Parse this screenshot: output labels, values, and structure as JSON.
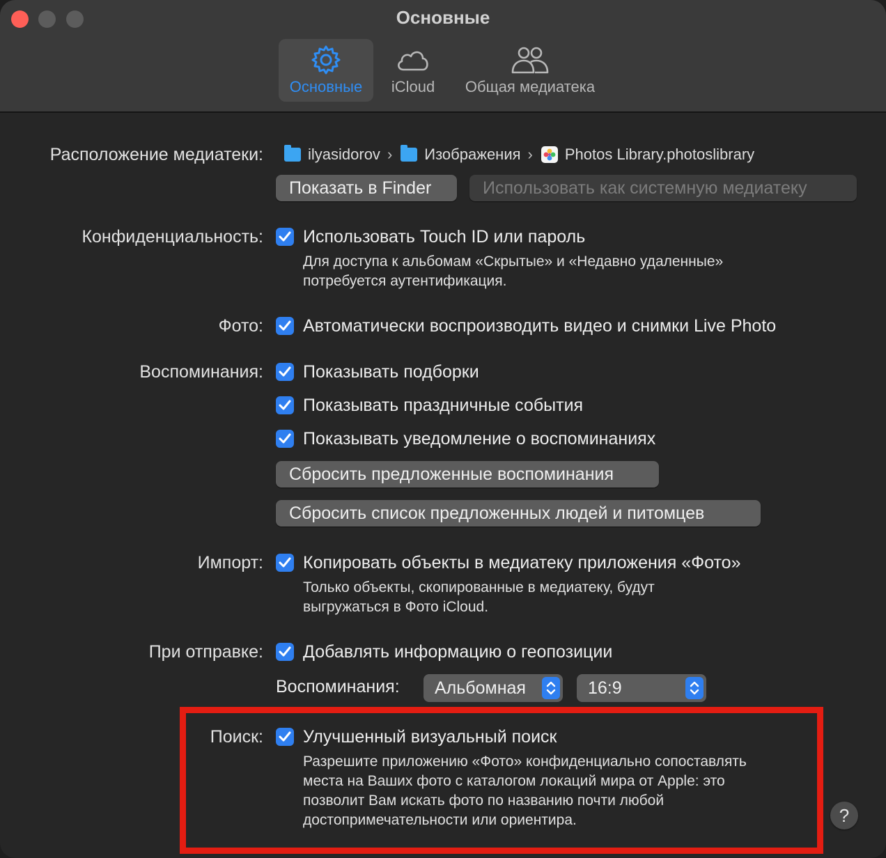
{
  "window": {
    "title": "Основные"
  },
  "tabs": [
    {
      "label": "Основные",
      "icon": "gear-icon",
      "active": true
    },
    {
      "label": "iCloud",
      "icon": "cloud-icon",
      "active": false
    },
    {
      "label": "Общая медиатека",
      "icon": "people-icon",
      "active": false
    }
  ],
  "library": {
    "label": "Расположение медиатеки:",
    "path": [
      {
        "name": "ilyasidorov",
        "icon": "home-folder-icon"
      },
      {
        "name": "Изображения",
        "icon": "pictures-folder-icon"
      },
      {
        "name": "Photos Library.photoslibrary",
        "icon": "photos-library-icon"
      }
    ],
    "show_in_finder": "Показать в Finder",
    "use_as_system": "Использовать как системную медиатеку"
  },
  "privacy": {
    "label": "Конфиденциальность:",
    "option": "Использовать Touch ID или пароль",
    "note_line1": "Для доступа к альбомам «Скрытые» и «Недавно удаленные»",
    "note_line2": "потребуется аутентификация.",
    "checked": true
  },
  "photos": {
    "label": "Фото:",
    "option": "Автоматически воспроизводить видео и снимки Live Photo",
    "checked": true
  },
  "memories": {
    "label": "Воспоминания:",
    "options": [
      {
        "text": "Показывать подборки",
        "checked": true
      },
      {
        "text": "Показывать праздничные события",
        "checked": true
      },
      {
        "text": "Показывать уведомление о воспоминаниях",
        "checked": true
      }
    ],
    "reset_suggested": "Сбросить предложенные воспоминания",
    "reset_people": "Сбросить список предложенных людей и питомцев"
  },
  "import": {
    "label": "Импорт:",
    "option": "Копировать объекты в медиатеку приложения «Фото»",
    "note_line1": "Только объекты, скопированные в медиатеку, будут",
    "note_line2": "выгружаться в Фото iCloud.",
    "checked": true
  },
  "sharing": {
    "label": "При отправке:",
    "option": "Добавлять информацию о геопозиции",
    "checked": true,
    "memories_label": "Воспоминания:",
    "orientation": "Альбомная",
    "aspect": "16:9"
  },
  "search": {
    "label": "Поиск:",
    "option": "Улучшенный визуальный поиск",
    "checked": true,
    "note_lines": [
      "Разрешите приложению «Фото» конфиденциально сопоставлять",
      "места на Ваших фото с каталогом локаций мира от Apple: это",
      "позволит Вам искать фото по названию почти любой",
      "достопримечательности или ориентира."
    ]
  },
  "help": {
    "label": "?"
  },
  "colors": {
    "accent": "#2f7ff0",
    "highlight": "#e31d12",
    "close": "#fe5f57"
  }
}
